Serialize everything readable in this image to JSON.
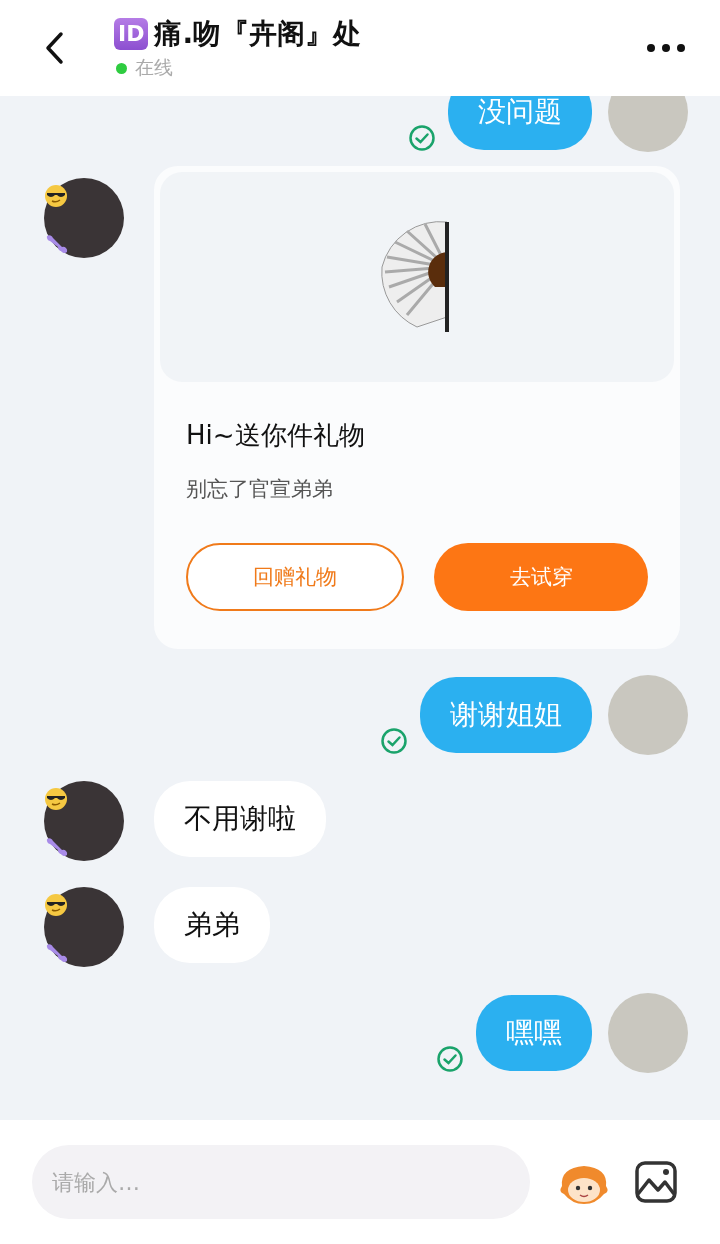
{
  "header": {
    "badge": "ID",
    "title": "痛.吻『卉阁』处",
    "status": "在线",
    "online": true
  },
  "messages": [
    {
      "kind": "text",
      "outgoing": true,
      "text": "没问题",
      "read": true
    },
    {
      "kind": "gift",
      "outgoing": false,
      "title": "Hi~送你件礼物",
      "subtitle": "别忘了官宣弟弟",
      "buttons": [
        {
          "label": "回赠礼物",
          "primary": false
        },
        {
          "label": "去试穿",
          "primary": true
        }
      ]
    },
    {
      "kind": "text",
      "outgoing": true,
      "text": "谢谢姐姐",
      "read": true
    },
    {
      "kind": "text",
      "outgoing": false,
      "text": "不用谢啦"
    },
    {
      "kind": "text",
      "outgoing": false,
      "text": "弟弟"
    },
    {
      "kind": "text",
      "outgoing": true,
      "text": "嘿嘿",
      "read": true
    }
  ],
  "composer": {
    "placeholder": "请输入…"
  }
}
